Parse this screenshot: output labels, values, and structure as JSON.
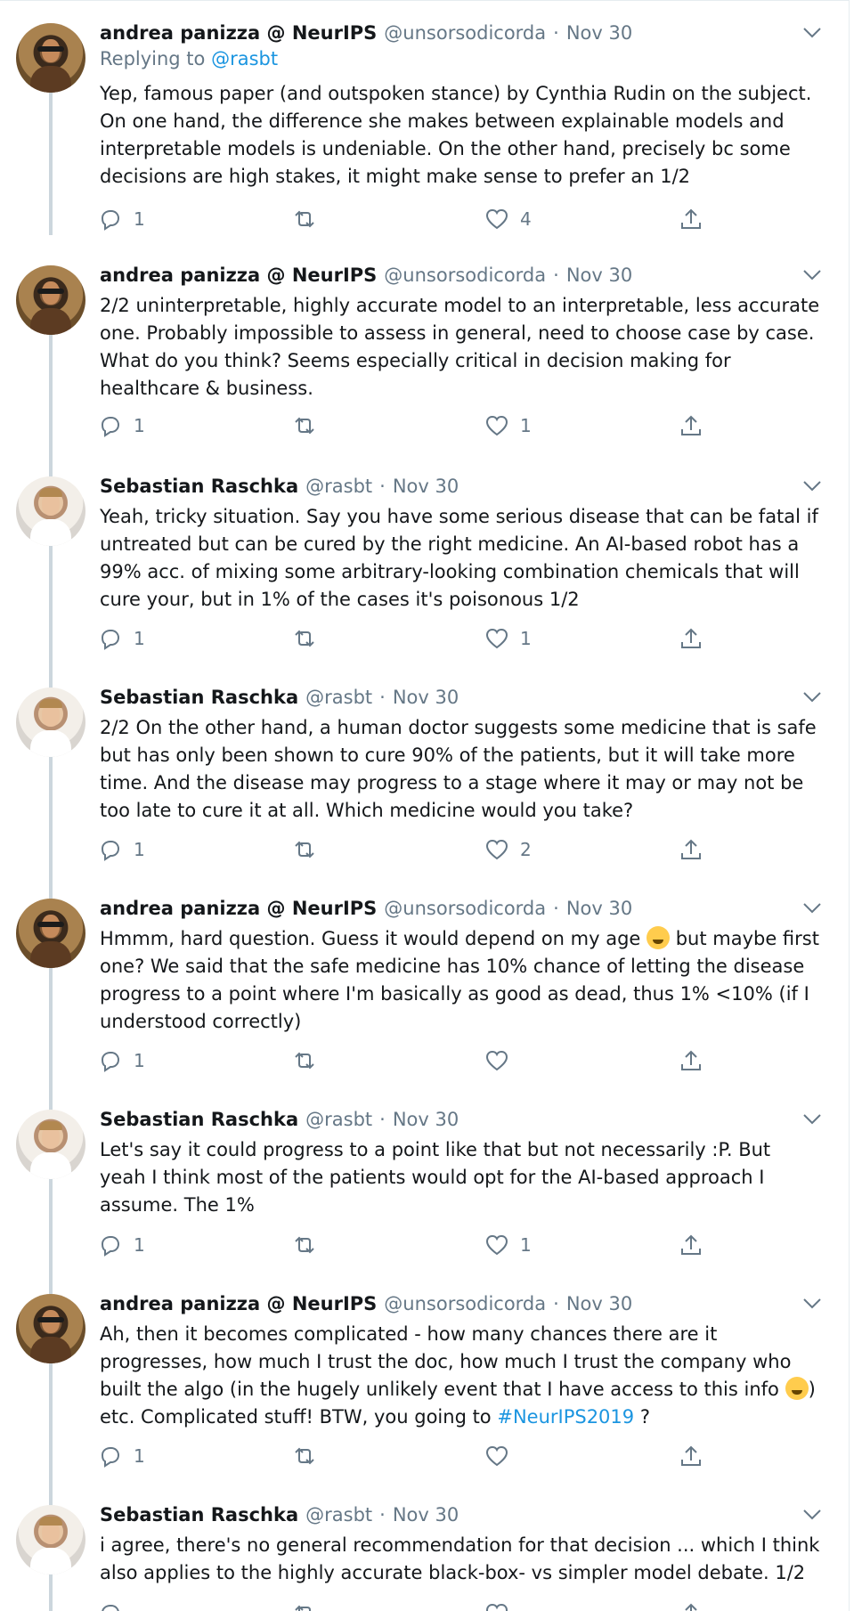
{
  "tweets": [
    {
      "author": "andrea panizza @ NeurIPS",
      "handle": "@unsorsodicorda",
      "sep": "·",
      "date": "Nov 30",
      "replying_prefix": "Replying to ",
      "replying_to": "@rasbt",
      "text": "Yep, famous paper (and outspoken stance) by Cynthia Rudin on the subject. On one hand, the difference she makes between explainable models and interpretable models is undeniable. On the other hand, precisely bc some decisions are high stakes, it might make sense to prefer an 1/2",
      "reply_count": "1",
      "retweet_count": "",
      "like_count": "4"
    },
    {
      "author": "andrea panizza @ NeurIPS",
      "handle": "@unsorsodicorda",
      "sep": "·",
      "date": "Nov 30",
      "text": "2/2 uninterpretable, highly accurate model to an interpretable, less accurate one. Probably impossible to assess in general, need to choose case by case. What do you think? Seems especially critical in decision making for healthcare & business.",
      "reply_count": "1",
      "retweet_count": "",
      "like_count": "1"
    },
    {
      "author": "Sebastian Raschka",
      "handle": "@rasbt",
      "sep": "·",
      "date": "Nov 30",
      "text": "Yeah, tricky situation. Say you have some serious disease that can be fatal if untreated but can be cured by the right medicine. An AI-based robot has a 99% acc. of mixing some arbitrary-looking combination chemicals that will cure your, but in 1% of the cases it's poisonous 1/2",
      "reply_count": "1",
      "retweet_count": "",
      "like_count": "1"
    },
    {
      "author": "Sebastian Raschka",
      "handle": "@rasbt",
      "sep": "·",
      "date": "Nov 30",
      "text": "2/2 On the other hand, a human doctor suggests some medicine that is safe but has only been shown to cure 90% of the patients, but it will take more time. And the disease may progress to a stage where it may or may not be too late to cure it at all. Which medicine would you take?",
      "reply_count": "1",
      "retweet_count": "",
      "like_count": "2"
    },
    {
      "author": "andrea panizza @ NeurIPS",
      "handle": "@unsorsodicorda",
      "sep": "·",
      "date": "Nov 30",
      "text_before": "Hmmm, hard question. Guess it would depend on my age ",
      "emoji": "grinning-sweat-emoji",
      "text_after": " but maybe first one? We said that the safe medicine has 10% chance of letting the disease progress to a point where I'm basically as good as dead, thus 1% <10% (if I understood correctly)",
      "reply_count": "1",
      "retweet_count": "",
      "like_count": ""
    },
    {
      "author": "Sebastian Raschka",
      "handle": "@rasbt",
      "sep": "·",
      "date": "Nov 30",
      "text": "Let's say it could progress to a point like that but not necessarily :P. But yeah I think most of the patients would opt for the AI-based approach I assume. The 1%",
      "reply_count": "1",
      "retweet_count": "",
      "like_count": "1"
    },
    {
      "author": "andrea panizza @ NeurIPS",
      "handle": "@unsorsodicorda",
      "sep": "·",
      "date": "Nov 30",
      "text_before": "Ah, then it becomes complicated - how many chances there are it progresses, how much I trust the doc, how much I trust the company who built the algo (in the hugely unlikely event that I have access to this info ",
      "emoji": "winking-tongue-emoji",
      "text_mid": ") etc. Complicated stuff! BTW, you going to ",
      "hashtag": "#NeurIPS2019",
      "text_after": " ?",
      "reply_count": "1",
      "retweet_count": "",
      "like_count": ""
    },
    {
      "author": "Sebastian Raschka",
      "handle": "@rasbt",
      "sep": "·",
      "date": "Nov 30",
      "text": "i agree, there's no general recommendation for that decision ... which I think also applies to the highly accurate black-box- vs simpler model debate. 1/2"
    }
  ],
  "colors": {
    "text": "#14171a",
    "secondary": "#657786",
    "link": "#1b95e0",
    "thread_line": "#ccd6dd"
  },
  "icons": [
    "reply-icon",
    "retweet-icon",
    "like-icon",
    "share-icon",
    "caret-down-icon"
  ]
}
